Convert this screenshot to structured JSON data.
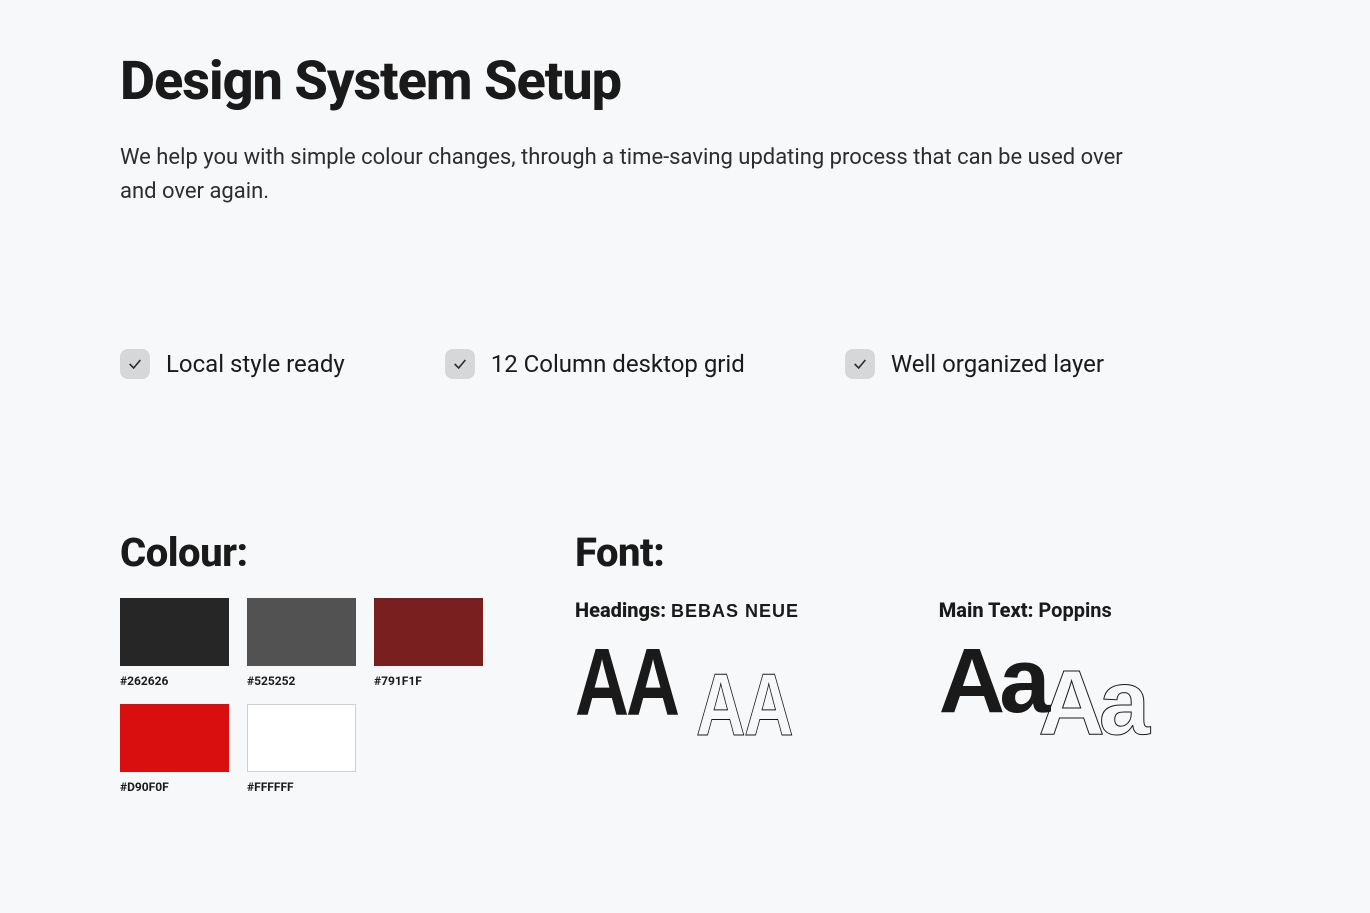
{
  "header": {
    "title": "Design System Setup",
    "subtitle": "We help you with simple colour changes, through a time-saving updating process that can be used over and over again."
  },
  "features": [
    {
      "label": "Local style ready"
    },
    {
      "label": "12 Column desktop grid"
    },
    {
      "label": "Well organized layer"
    }
  ],
  "colour": {
    "heading": "Colour:",
    "swatches": [
      {
        "hex": "#262626",
        "value": "#262626"
      },
      {
        "hex": "#525252",
        "value": "#525252"
      },
      {
        "hex": "#791F1F",
        "value": "#791F1F"
      },
      {
        "hex": "#D90F0F",
        "value": "#D90F0F"
      },
      {
        "hex": "#FFFFFF",
        "value": "#FFFFFF"
      }
    ]
  },
  "font": {
    "heading": "Font:",
    "headings_label": "Headings:",
    "headings_face": "BEBAS NEUE",
    "headings_sample_solid": "AA",
    "headings_sample_outline": "AA",
    "main_label": "Main Text:",
    "main_face": "Poppins",
    "main_sample_solid": "Aa",
    "main_sample_outline": "Aa"
  }
}
